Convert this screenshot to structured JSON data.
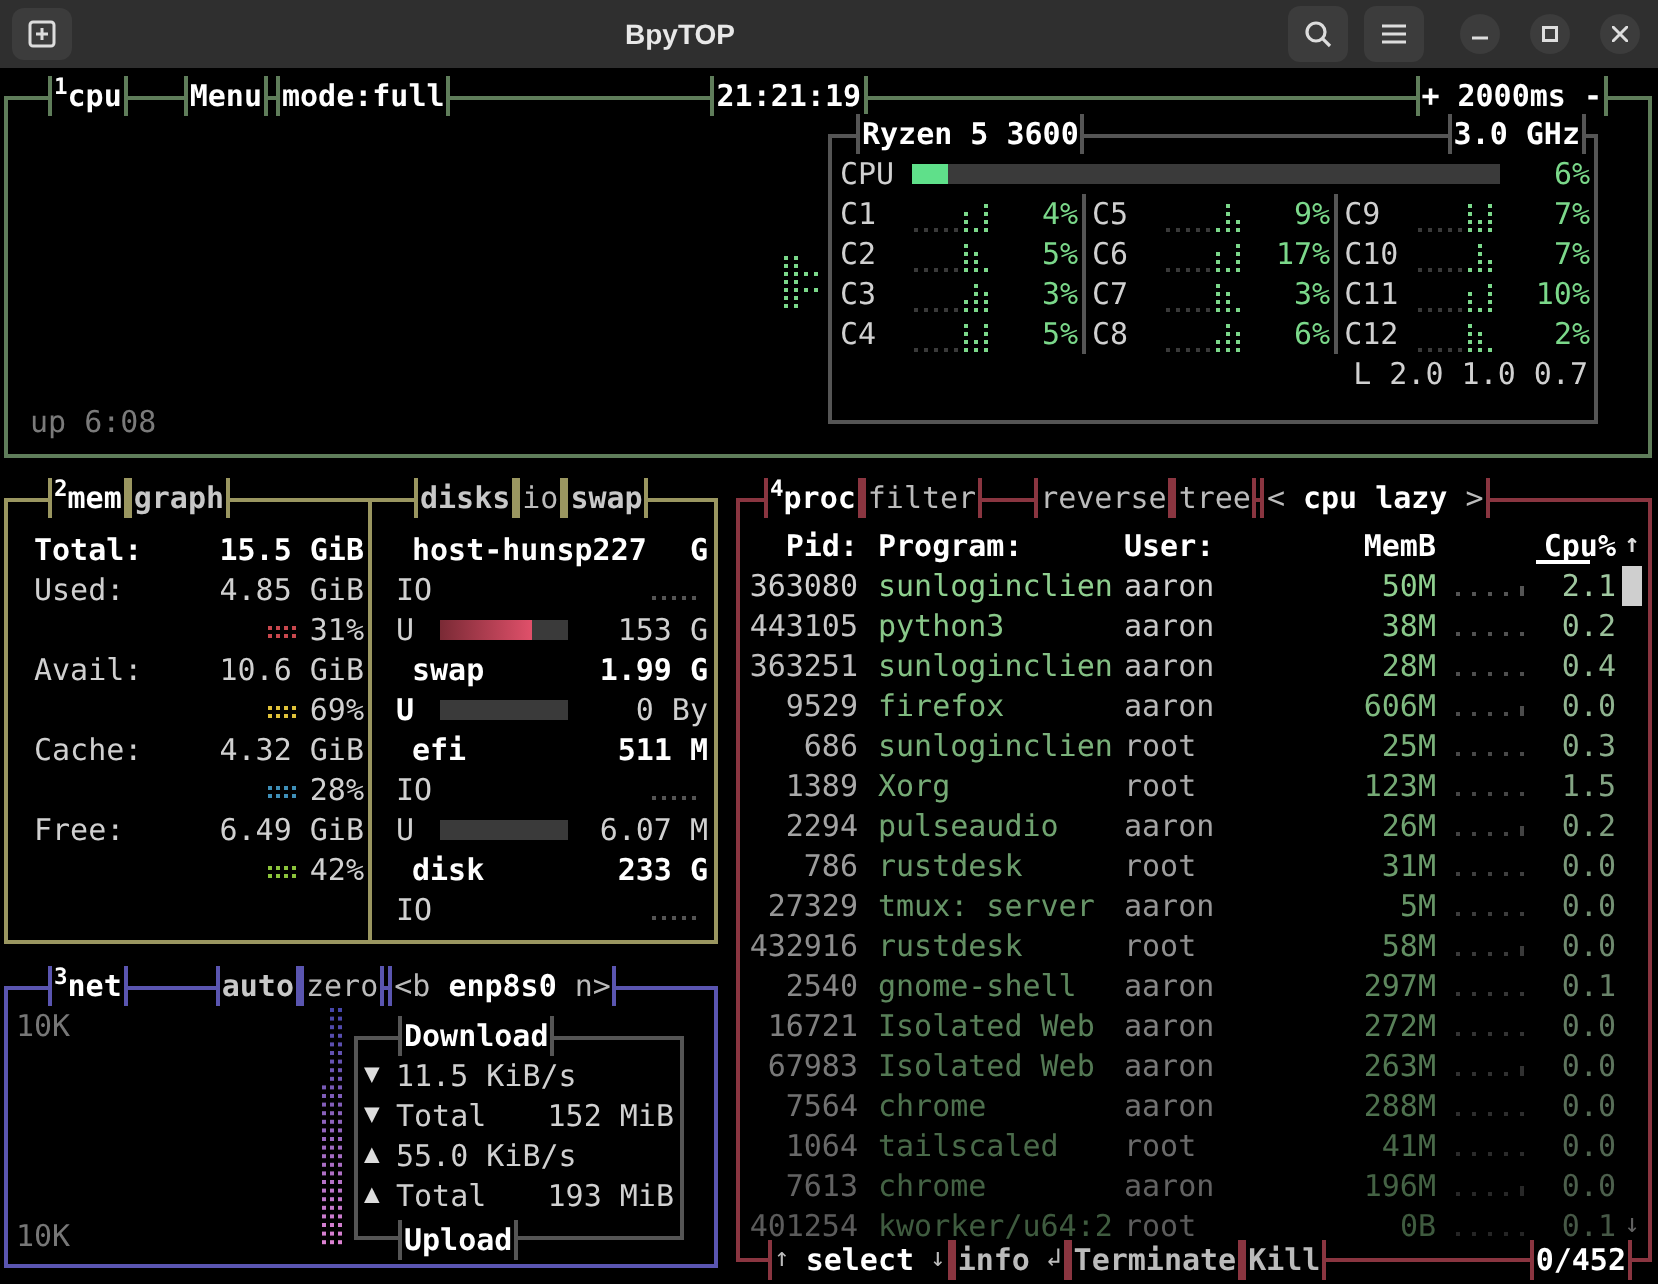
{
  "window": {
    "title": "BpyTOP"
  },
  "cpu": {
    "title": "$^{1}$cpu",
    "menu": "Menu",
    "mode": "mode:full",
    "clock": "21:21:19",
    "interval": "+ 2000ms -",
    "uptime": "up 6:08",
    "model": "Ryzen 5 3600",
    "freq": "3.0 GHz",
    "total": {
      "label": "CPU",
      "level": 0.06,
      "value": "6%"
    },
    "cores": [
      {
        "label": "C1",
        "value": "4%"
      },
      {
        "label": "C2",
        "value": "5%"
      },
      {
        "label": "C3",
        "value": "3%"
      },
      {
        "label": "C4",
        "value": "5%"
      },
      {
        "label": "C5",
        "value": "9%"
      },
      {
        "label": "C6",
        "value": "17%"
      },
      {
        "label": "C7",
        "value": "3%"
      },
      {
        "label": "C8",
        "value": "6%"
      },
      {
        "label": "C9",
        "value": "7%"
      },
      {
        "label": "C10",
        "value": "7%"
      },
      {
        "label": "C11",
        "value": "10%"
      },
      {
        "label": "C12",
        "value": "2%"
      }
    ],
    "load": "L 2.0 1.0 0.7"
  },
  "mem": {
    "title": "$^{2}$mem",
    "mode": "graph",
    "total": {
      "label": "Total:",
      "value": "15.5 GiB"
    },
    "rows": [
      {
        "label": "Used:",
        "value": "4.85 GiB",
        "percent": "31%",
        "color": "#c8484e"
      },
      {
        "label": "Avail:",
        "value": "10.6 GiB",
        "percent": "69%",
        "color": "#e0c23a"
      },
      {
        "label": "Cache:",
        "value": "4.32 GiB",
        "percent": "28%",
        "color": "#3f8fb8"
      },
      {
        "label": "Free:",
        "value": "6.49 GiB",
        "percent": "42%",
        "color": "#8cc43c"
      }
    ]
  },
  "disks": {
    "tabs": [
      "disks",
      "io",
      "swap"
    ],
    "items": [
      {
        "name": "host-hunsp227",
        "total": "G",
        "io": "IO",
        "used": {
          "label": "U",
          "level": 0.72,
          "value": "153 G"
        }
      },
      {
        "name": "swap",
        "total": "1.99 G",
        "used": {
          "label": "U",
          "level": 0,
          "value": "0 By"
        }
      },
      {
        "name": "efi",
        "total": "511 M",
        "io": "IO",
        "used": {
          "label": "U",
          "level": 0,
          "value": "6.07 M"
        }
      },
      {
        "name": "disk",
        "total": "233 G",
        "io": "IO"
      }
    ]
  },
  "net": {
    "title": "$^{3}$net",
    "auto": "auto",
    "zero": "zero",
    "prev": "<b",
    "iface": "enp8s0",
    "next": "n>",
    "scale_top": "10K",
    "scale_bottom": "10K",
    "download": "Download",
    "upload": "Upload",
    "stats": [
      {
        "arrow": "▼",
        "label": "11.5 KiB/s"
      },
      {
        "arrow": "▼",
        "label": "Total",
        "value": "152 MiB"
      },
      {
        "arrow": "▲",
        "label": "55.0 KiB/s"
      },
      {
        "arrow": "▲",
        "label": "Total",
        "value": "193 MiB"
      }
    ]
  },
  "proc": {
    "title": "$^{4}$proc",
    "filter": "filter",
    "reverse": "reverse",
    "tree": "tree",
    "sort_prev": "<",
    "sort": "cpu lazy",
    "sort_next": ">",
    "columns": [
      "Pid:",
      "Program:",
      "User:",
      "MemB",
      "Cpu%"
    ],
    "scroll_up": "↑",
    "scroll_down": "↓",
    "rows": [
      {
        "pid": "363080",
        "program": "sunloginclien",
        "user": "aaron",
        "mem": "50M",
        "cpu": "2.1"
      },
      {
        "pid": "443105",
        "program": "python3",
        "user": "aaron",
        "mem": "38M",
        "cpu": "0.2"
      },
      {
        "pid": "363251",
        "program": "sunloginclien",
        "user": "aaron",
        "mem": "28M",
        "cpu": "0.4"
      },
      {
        "pid": "9529",
        "program": "firefox",
        "user": "aaron",
        "mem": "606M",
        "cpu": "0.0"
      },
      {
        "pid": "686",
        "program": "sunloginclien",
        "user": "root",
        "mem": "25M",
        "cpu": "0.3"
      },
      {
        "pid": "1389",
        "program": "Xorg",
        "user": "root",
        "mem": "123M",
        "cpu": "1.5"
      },
      {
        "pid": "2294",
        "program": "pulseaudio",
        "user": "aaron",
        "mem": "26M",
        "cpu": "0.2"
      },
      {
        "pid": "786",
        "program": "rustdesk",
        "user": "root",
        "mem": "31M",
        "cpu": "0.0"
      },
      {
        "pid": "27329",
        "program": "tmux: server",
        "user": "aaron",
        "mem": "5M",
        "cpu": "0.0"
      },
      {
        "pid": "432916",
        "program": "rustdesk",
        "user": "root",
        "mem": "58M",
        "cpu": "0.0"
      },
      {
        "pid": "2540",
        "program": "gnome-shell",
        "user": "aaron",
        "mem": "297M",
        "cpu": "0.1"
      },
      {
        "pid": "16721",
        "program": "Isolated Web",
        "user": "aaron",
        "mem": "272M",
        "cpu": "0.0"
      },
      {
        "pid": "67983",
        "program": "Isolated Web",
        "user": "aaron",
        "mem": "263M",
        "cpu": "0.0"
      },
      {
        "pid": "7564",
        "program": "chrome",
        "user": "aaron",
        "mem": "288M",
        "cpu": "0.0"
      },
      {
        "pid": "1064",
        "program": "tailscaled",
        "user": "root",
        "mem": "41M",
        "cpu": "0.0"
      },
      {
        "pid": "7613",
        "program": "chrome",
        "user": "aaron",
        "mem": "196M",
        "cpu": "0.0"
      },
      {
        "pid": "401254",
        "program": "kworker/u64:2",
        "user": "root",
        "mem": "0B",
        "cpu": "0.1"
      }
    ],
    "footer": {
      "up": "↑",
      "select": "select",
      "down": "↓",
      "info": "info",
      "enter": "↲",
      "terminate": "Terminate",
      "kill": "Kill",
      "count": "0/452"
    }
  }
}
